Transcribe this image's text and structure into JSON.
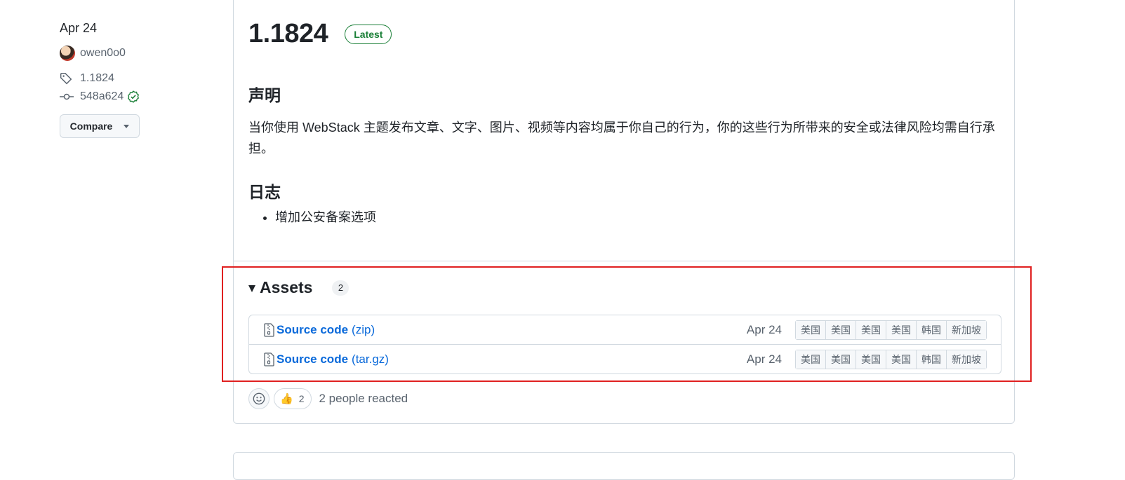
{
  "sidebar": {
    "date": "Apr 24",
    "author": "owen0o0",
    "tag": "1.1824",
    "commit": "548a624",
    "compare_label": "Compare"
  },
  "release": {
    "title": "1.1824",
    "badge": "Latest",
    "sections": [
      {
        "heading": "声明",
        "text": "当你使用 WebStack 主题发布文章、文字、图片、视频等内容均属于你自己的行为，你的这些行为所带来的安全或法律风险均需自行承担。"
      },
      {
        "heading": "日志",
        "items": [
          "增加公安备案选项"
        ]
      }
    ]
  },
  "assets": {
    "label": "Assets",
    "count": "2",
    "rows": [
      {
        "name": "Source code",
        "ext": "(zip)",
        "date": "Apr 24",
        "mirrors": [
          "美国",
          "美国",
          "美国",
          "美国",
          "韩国",
          "新加坡"
        ]
      },
      {
        "name": "Source code",
        "ext": "(tar.gz)",
        "date": "Apr 24",
        "mirrors": [
          "美国",
          "美国",
          "美国",
          "美国",
          "韩国",
          "新加坡"
        ]
      }
    ]
  },
  "reactions": {
    "thumbs_count": "2",
    "summary": "2 people reacted"
  },
  "colors": {
    "link": "#0969da",
    "success": "#1a7f37",
    "highlight": "#e02020"
  }
}
